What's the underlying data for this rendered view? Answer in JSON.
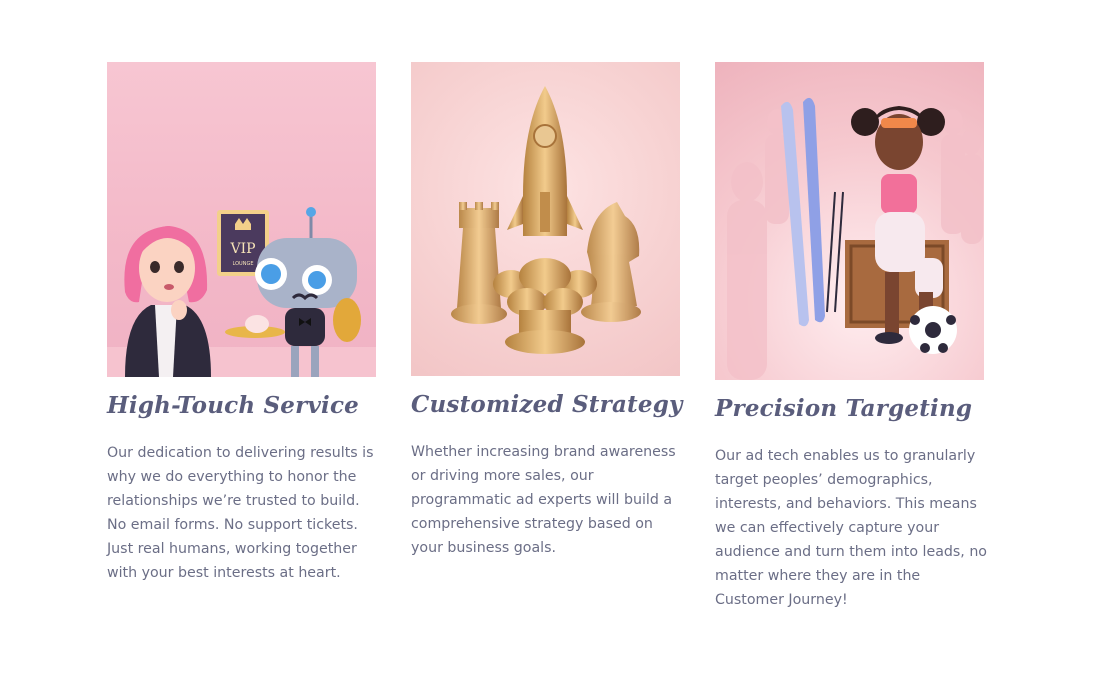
{
  "features": [
    {
      "title": "High-Touch Service",
      "description": "Our dedication to delivering results is why we do everything to honor the relationships we’re trusted to build. No email forms. No support tickets. Just real humans, working together with your best interests at heart.",
      "sign_title": "VIP",
      "sign_subtitle": "LOUNGE"
    },
    {
      "title": "Customized Strategy",
      "description": "Whether increasing brand awareness or driving more sales, our programmatic ad experts will build a comprehensive strategy based on your business goals."
    },
    {
      "title": "Precision Targeting",
      "description": "Our ad tech enables us to granularly target peoples’ demographics, interests, and behaviors. This means we can effectively capture your audience and turn them into leads, no matter where they are in the Customer Journey!"
    }
  ]
}
